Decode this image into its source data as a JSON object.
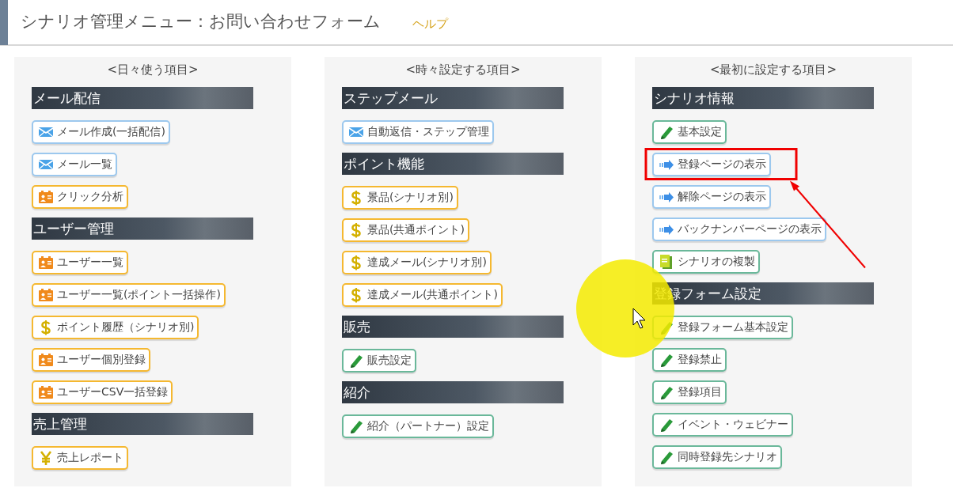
{
  "header": {
    "title": "シナリオ管理メニュー：お問い合わせフォーム",
    "help_link": "ヘルプ"
  },
  "columns": [
    {
      "heading": "<日々使う項目>",
      "sections": [
        {
          "title": "メール配信",
          "items": [
            {
              "label": "メール作成(一括配信)",
              "kind": "mail"
            },
            {
              "label": "メール一覧",
              "kind": "mail"
            },
            {
              "label": "クリック分析",
              "kind": "card"
            }
          ]
        },
        {
          "title": "ユーザー管理",
          "items": [
            {
              "label": "ユーザー一覧",
              "kind": "card"
            },
            {
              "label": "ユーザー一覧(ポイント一括操作)",
              "kind": "card"
            },
            {
              "label": "ポイント履歴（シナリオ別)",
              "kind": "dollar"
            },
            {
              "label": "ユーザー個別登録",
              "kind": "card"
            },
            {
              "label": "ユーザーCSV一括登録",
              "kind": "card"
            }
          ]
        },
        {
          "title": "売上管理",
          "items": [
            {
              "label": "売上レポート",
              "kind": "yen"
            }
          ]
        }
      ]
    },
    {
      "heading": "<時々設定する項目>",
      "sections": [
        {
          "title": "ステップメール",
          "items": [
            {
              "label": "自動返信・ステップ管理",
              "kind": "mail"
            }
          ]
        },
        {
          "title": "ポイント機能",
          "items": [
            {
              "label": "景品(シナリオ別)",
              "kind": "dollar"
            },
            {
              "label": "景品(共通ポイント)",
              "kind": "dollar"
            },
            {
              "label": "達成メール(シナリオ別)",
              "kind": "dollar"
            },
            {
              "label": "達成メール(共通ポイント)",
              "kind": "dollar"
            }
          ]
        },
        {
          "title": "販売",
          "items": [
            {
              "label": "販売設定",
              "kind": "pencil"
            }
          ]
        },
        {
          "title": "紹介",
          "items": [
            {
              "label": "紹介（パートナー）設定",
              "kind": "pencil"
            }
          ]
        }
      ]
    },
    {
      "heading": "<最初に設定する項目>",
      "sections": [
        {
          "title": "シナリオ情報",
          "items": [
            {
              "label": "基本設定",
              "kind": "pencil"
            },
            {
              "label": "登録ページの表示",
              "kind": "arrow",
              "highlighted": true
            },
            {
              "label": "解除ページの表示",
              "kind": "arrow"
            },
            {
              "label": "バックナンバーページの表示",
              "kind": "arrow"
            },
            {
              "label": "シナリオの複製",
              "kind": "copy"
            }
          ]
        },
        {
          "title": "登録フォーム設定",
          "items": [
            {
              "label": "登録フォーム基本設定",
              "kind": "pencil"
            },
            {
              "label": "登録禁止",
              "kind": "pencil"
            },
            {
              "label": "登録項目",
              "kind": "pencil"
            },
            {
              "label": "イベント・ウェビナー",
              "kind": "pencil"
            },
            {
              "label": "同時登録先シナリオ",
              "kind": "pencil"
            }
          ]
        }
      ]
    }
  ]
}
